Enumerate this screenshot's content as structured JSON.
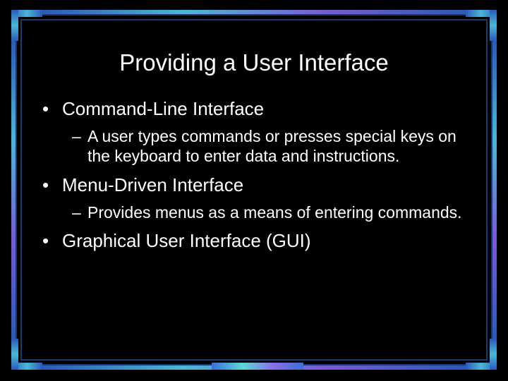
{
  "slide": {
    "title": "Providing a User Interface",
    "bullets": [
      {
        "label": "Command-Line Interface",
        "sub": [
          "A user types commands or presses special keys on the keyboard to enter data and instructions."
        ]
      },
      {
        "label": "Menu-Driven Interface",
        "sub": [
          "Provides menus as a means of entering commands."
        ]
      },
      {
        "label": "Graphical User Interface (GUI)",
        "sub": []
      }
    ]
  }
}
